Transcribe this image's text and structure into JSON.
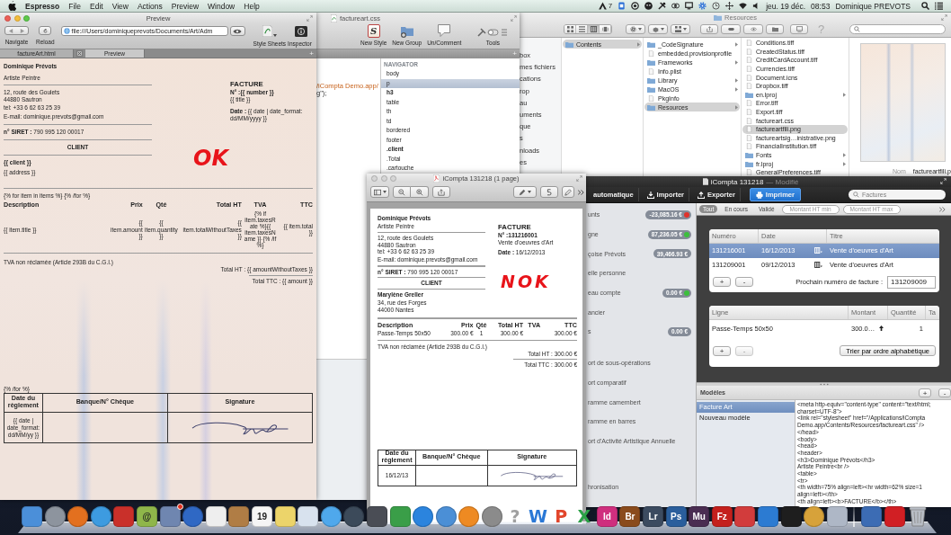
{
  "menu_bar": {
    "app_name": "Espresso",
    "menus": [
      "File",
      "Edit",
      "View",
      "Actions",
      "Preview",
      "Window",
      "Help"
    ],
    "status_count": "7",
    "date": "jeu. 19 déc.",
    "time": "08:53",
    "user": "Dominique PREVOTS"
  },
  "finder_window": {
    "title": "Resources",
    "view_buttons": [
      {
        "kind": "icons",
        "selected": false
      },
      {
        "kind": "list",
        "selected": false
      },
      {
        "kind": "columns",
        "selected": true
      },
      {
        "kind": "coverflow",
        "selected": false
      }
    ],
    "help": "?",
    "sidebar": [
      "box",
      "mes fichiers",
      "cations",
      "rop",
      "au",
      "uments",
      "que",
      "s",
      "nloads",
      "es"
    ],
    "columns": [
      [
        {
          "name": "Contents",
          "kind": "folder",
          "selected": true
        }
      ],
      [
        {
          "name": "_CodeSignature",
          "kind": "folder",
          "selected": false
        },
        {
          "name": "embedded.provisionprofile",
          "kind": "file",
          "selected": false
        },
        {
          "name": "Frameworks",
          "kind": "folder",
          "selected": false
        },
        {
          "name": "Info.plist",
          "kind": "file",
          "selected": false
        },
        {
          "name": "Library",
          "kind": "folder",
          "selected": false
        },
        {
          "name": "MacOS",
          "kind": "folder",
          "selected": false
        },
        {
          "name": "PkgInfo",
          "kind": "file",
          "selected": false
        },
        {
          "name": "Resources",
          "kind": "folder",
          "selected": true
        }
      ],
      [
        {
          "name": "Conditions.tiff",
          "kind": "file",
          "selected": false
        },
        {
          "name": "CreatedStatus.tiff",
          "kind": "file",
          "selected": false
        },
        {
          "name": "CreditCardAccount.tiff",
          "kind": "file",
          "selected": false
        },
        {
          "name": "Currencies.tiff",
          "kind": "file",
          "selected": false
        },
        {
          "name": "Document.icns",
          "kind": "file",
          "selected": false
        },
        {
          "name": "Dropbox.tiff",
          "kind": "file",
          "selected": false
        },
        {
          "name": "en.lproj",
          "kind": "folder",
          "selected": false
        },
        {
          "name": "Error.tiff",
          "kind": "file",
          "selected": false
        },
        {
          "name": "Export.tiff",
          "kind": "file",
          "selected": false
        },
        {
          "name": "factureart.css",
          "kind": "file",
          "selected": false
        },
        {
          "name": "factureartfili.png",
          "kind": "file",
          "selected": true
        },
        {
          "name": "factureartsig…inistrative.png",
          "kind": "file",
          "selected": false
        },
        {
          "name": "FinancialInstitution.tiff",
          "kind": "file",
          "selected": false
        },
        {
          "name": "Fonts",
          "kind": "folder",
          "selected": false
        },
        {
          "name": "fr.lproj",
          "kind": "folder",
          "selected": false
        },
        {
          "name": "GeneralPreferences.tiff",
          "kind": "file",
          "selected": false
        }
      ]
    ],
    "preview": {
      "label": "Nom",
      "value": "factureartfili.p"
    }
  },
  "css_window": {
    "title": "factureart.css",
    "tools": [
      {
        "kind": "style",
        "label": "New Style",
        "glyph": "S"
      },
      {
        "kind": "group",
        "label": "New Group"
      },
      {
        "kind": "comment",
        "label": "Un/Comment"
      },
      {
        "kind": "tools",
        "label": "Tools"
      }
    ],
    "add_tab": "+",
    "code": [
      {
        "text": "/iCompta Demo.app/",
        "kind": "string"
      },
      {
        "text": "g\");",
        "kind": "plain"
      }
    ],
    "navigator": {
      "heading": "NAVIGATOR",
      "items": [
        {
          "label": "body",
          "selected": false,
          "highlighted": false
        },
        {
          "label": "p",
          "selected": true,
          "highlighted": false
        },
        {
          "label": "h3",
          "selected": false,
          "highlighted": true
        },
        {
          "label": "table",
          "selected": false,
          "highlighted": false
        },
        {
          "label": "th",
          "selected": false,
          "highlighted": false
        },
        {
          "label": "td",
          "selected": false,
          "highlighted": false
        },
        {
          "label": "bordered",
          "selected": false,
          "highlighted": false
        },
        {
          "label": "footer",
          "selected": false,
          "highlighted": false
        },
        {
          "label": ".client",
          "selected": false,
          "highlighted": true
        },
        {
          "label": ".Total",
          "selected": false,
          "highlighted": false
        },
        {
          "label": ".cartouche",
          "selected": false,
          "highlighted": false
        }
      ]
    }
  },
  "icompta_window": {
    "title": "iCompta 131218",
    "status": "— Modifié",
    "toolbar": [
      {
        "kind": "plain",
        "label": "automatique",
        "selected": false
      },
      {
        "kind": "import",
        "label": "Importer",
        "selected": false
      },
      {
        "kind": "export",
        "label": "Exporter",
        "selected": false
      },
      {
        "kind": "print",
        "label": "Imprimer",
        "selected": true
      }
    ],
    "search": {
      "placeholder": "Factures"
    },
    "sidebar_groups": [
      {
        "items": [
          {
            "label": "unts",
            "amount": "-23,085.16 €",
            "color": "#e0322b"
          },
          {
            "label": "gne",
            "amount": "87,236.05 €",
            "color": "#3cbf3c"
          },
          {
            "label": "çoise Prévots",
            "amount": "39,466.93 €"
          },
          {
            "label": "elle personne"
          },
          {
            "label": "eau compte",
            "amount": "0.00 €",
            "color": "#3cbf3c"
          },
          {
            "label": "ancier"
          },
          {
            "label": "s",
            "amount": "0.00 €"
          }
        ]
      },
      {
        "items": [
          {
            "label": "ort de sous-opérations"
          },
          {
            "label": "ort comparatif"
          },
          {
            "label": "ramme camembert"
          },
          {
            "label": "ramme en barres"
          },
          {
            "label": "ort d'Activité Artistique Annuelle"
          }
        ]
      },
      {
        "items": [
          {
            "label": "hronisation"
          }
        ]
      }
    ],
    "filters": [
      {
        "label": "Tout",
        "selected": true
      },
      {
        "label": "En cours",
        "selected": false
      },
      {
        "label": "Validé",
        "selected": false
      }
    ],
    "range_fields": [
      {
        "placeholder": "Montant HT min"
      },
      {
        "placeholder": "Montant HT max"
      }
    ],
    "invoices": {
      "columns": [
        "Numéro",
        "Date",
        "Titre"
      ],
      "rows": [
        {
          "number": "131216001",
          "date": "16/12/2013",
          "title": "Vente d'oeuvres d'Art",
          "selected": true
        },
        {
          "number": "131209001",
          "date": "09/12/2013",
          "title": "Vente d'oeuvres d'Art",
          "selected": false
        }
      ],
      "add": "+",
      "remove": {
        "label": "-",
        "disabled": false
      },
      "next_label": "Prochain numéro de facture :",
      "next_value": "131209009"
    },
    "lines": {
      "columns": [
        "Ligne",
        "Montant",
        "Quantité",
        "Ta"
      ],
      "rows": [
        {
          "label": "Passe-Temps 50x50",
          "amount": "300.0…",
          "quantity": "1"
        }
      ],
      "add": "+",
      "remove": {
        "label": "-",
        "disabled": true
      },
      "sort_button": "Trier par ordre alphabétique"
    },
    "models": {
      "heading": "Modèles",
      "add": "+",
      "remove": "-",
      "items": [
        {
          "label": "Facture Art",
          "selected": true
        },
        {
          "label": "Nouveau modèle",
          "selected": false
        }
      ],
      "code": [
        "<meta http-equiv=\"content-type\" content=\"text/html;",
        "charset=UTF-8\">",
        "<link rel=\"stylesheet\" href=\"/Applications/iCompta",
        "Demo.app/Contents/Resources/factureart.css\" />",
        "</head>",
        "<body>",
        "<head>",
        "<header>",
        "<h3>Dominique Prévots</h3>",
        "Artiste Peintre<br />",
        "<table>",
        "<tr>",
        "<th width=75% align=left><hr width=62% size=1",
        "align=left></th>",
        "<th align=left><b>FACTURE</b></th>"
      ]
    }
  },
  "preview_window": {
    "title": "Preview",
    "navigate_label": "Navigate",
    "reload_label": "Reload",
    "url": "file:///Users/dominiqueprevots/Documents/Art/Adm",
    "style_sheets_label": "Style Sheets",
    "inspector_label": "Inspector",
    "tabs": [
      {
        "label": "factureArt.html",
        "selected": false
      },
      {
        "label": "Preview",
        "selected": true
      }
    ],
    "add_tab": "+",
    "annotation": "OK",
    "invoice": {
      "sender": {
        "name": "Dominique Prévots",
        "profession": "Artiste Peintre",
        "address": [
          "12, route des Goulets",
          "44880 Sautron",
          "tel: +33 6 62 63 25 39"
        ],
        "email": "E-mail: dominique.prevots@gmail.com"
      },
      "siret": "**n° SIRET :** 790 995 120 00017",
      "client_heading": "CLIENT",
      "client": {
        "name": "{{ client }}",
        "address": [
          "{{ address }}"
        ]
      },
      "heading": "FACTURE",
      "number": "N° :{{ number }}",
      "subtitle": "{{ title }}",
      "date": "**Date :** {{ date | date_format: dd/MM/yyyy }}",
      "loop_start": "{% for item in items %} {% /for %}",
      "columns": [
        "Description",
        "Prix",
        "Qté",
        "Total HT",
        "TVA",
        "TTC"
      ],
      "rows": [
        {
          "description": "{{ item.title }}",
          "price": "{{ item.amount }}",
          "quantity": "{{ item.quantity }}",
          "total_ht": "{{ item.totalWithoutTaxes }}",
          "tva": "{% if item.taxesRate %}{{ item.taxesName }} {% /if %}",
          "ttc": "{{ item.total }}"
        }
      ],
      "vat_note": "TVA non réclamée (Article 293B du C.G.I.)",
      "total_ht": "Total HT : {{ amountWithoutTaxes }}",
      "total_ttc": "Total TTC : {{ amount }}",
      "loop_end": "{% /for %}",
      "payment": {
        "columns": [
          "Date du règlement",
          "Banque/N° Chèque",
          "Signature"
        ],
        "date": "{{ date | date_format: dd/MM/yy }}"
      }
    }
  },
  "pdf_window": {
    "title": "iCompta 131218 (1 page)",
    "annotation": "NOK",
    "invoice": {
      "sender": {
        "name": "Dominique Prévots",
        "profession": "Artiste Peintre",
        "address": [
          "12, route des Goulets",
          "44880 Sautron",
          "tel: +33 6 62 63 25 39"
        ],
        "email": "E-mail: dominique.prevots@gmail.com"
      },
      "siret": "**n° SIRET :** 790 995 120 00017",
      "client_heading": "CLIENT",
      "client": {
        "name": "Marylène Greller",
        "address": [
          "34, rue des Forges",
          "44000 Nantes"
        ]
      },
      "heading": "FACTURE",
      "number": "N° :131216001",
      "subtitle": "Vente d'oeuvres d'Art",
      "date": "**Date :** 16/12/2013",
      "columns": [
        "Description",
        "Prix",
        "Qté",
        "Total HT",
        "TVA",
        "TTC"
      ],
      "rows": [
        {
          "description": "Passe-Temps 50x50",
          "price": "300.00 €",
          "quantity": "1",
          "total_ht": "300.00 €",
          "ttc": "300.00 €"
        }
      ],
      "vat_note": "TVA non réclamée (Article 293B du C.G.I.)",
      "total_ht": "Total HT : 300.00 €",
      "total_ttc": "Total TTC : 300.00 €",
      "payment": {
        "columns": [
          "Date du règlement",
          "Banque/N° Chèque",
          "Signature"
        ],
        "date": "16/12/13"
      }
    }
  },
  "dock": {
    "items": [
      {
        "kind": "tile",
        "color": "#4b8fd9",
        "badge": false
      },
      {
        "kind": "round",
        "color": "#8d949e",
        "badge": false
      },
      {
        "kind": "round",
        "color": "#e3701f",
        "badge": false
      },
      {
        "kind": "round",
        "color": "#3d9be0",
        "badge": false
      },
      {
        "kind": "tile",
        "color": "#c9302a",
        "badge": false
      },
      {
        "kind": "tile",
        "color": "#8fb64a",
        "label": "@",
        "badge": false
      },
      {
        "kind": "tile",
        "color": "#6f86b0",
        "badge": true
      },
      {
        "kind": "round",
        "color": "#2f68c4",
        "badge": false
      },
      {
        "kind": "tile",
        "color": "#eeeeee",
        "badge": false
      },
      {
        "kind": "tile",
        "color": "#b07d45",
        "badge": false
      },
      {
        "kind": "tile",
        "color": "#f5f5f5",
        "label": "19",
        "badge": false
      },
      {
        "kind": "tile",
        "color": "#ecd46a",
        "badge": false
      },
      {
        "kind": "tile",
        "color": "#d8e2ee",
        "badge": false
      },
      {
        "kind": "round",
        "color": "#4fa8ec",
        "badge": false
      },
      {
        "kind": "round",
        "color": "#3c4a5a",
        "badge": false
      },
      {
        "kind": "tile",
        "color": "#4a4d55",
        "badge": false
      },
      {
        "kind": "tile",
        "color": "#3a9e48",
        "badge": false
      },
      {
        "kind": "round",
        "color": "#2b84de",
        "badge": false
      },
      {
        "kind": "round",
        "color": "#4b8fd6",
        "badge": false
      },
      {
        "kind": "round",
        "color": "#ee8a22",
        "badge": false
      },
      {
        "kind": "round",
        "color": "#8b8b8b",
        "badge": false
      },
      {
        "kind": "glyph",
        "color": "#a0a0a0",
        "label": "?",
        "badge": false
      },
      {
        "kind": "glyph",
        "color": "#2a78d6",
        "label": "W",
        "badge": false
      },
      {
        "kind": "glyph",
        "color": "#e2462c",
        "label": "P",
        "badge": false
      },
      {
        "kind": "glyph",
        "color": "#2aa146",
        "label": "X",
        "badge": false
      },
      {
        "kind": "tile",
        "color": "#cf2f7e",
        "label": "Id",
        "badge": false
      },
      {
        "kind": "tile",
        "color": "#8a4b1c",
        "label": "Br",
        "badge": false
      },
      {
        "kind": "tile",
        "color": "#3c4b60",
        "label": "Lr",
        "badge": false
      },
      {
        "kind": "tile",
        "color": "#2a5e9c",
        "label": "Ps",
        "badge": false
      },
      {
        "kind": "tile",
        "color": "#4a2d52",
        "label": "Mu",
        "badge": false
      },
      {
        "kind": "tile",
        "color": "#c4201d",
        "label": "Fz",
        "badge": false
      },
      {
        "kind": "tile",
        "color": "#d23c3c",
        "badge": false
      },
      {
        "kind": "tile",
        "color": "#2c7bd2",
        "badge": false
      },
      {
        "kind": "tile",
        "color": "#1e1e1e",
        "badge": false
      },
      {
        "kind": "round",
        "color": "#d7a23a",
        "badge": false
      },
      {
        "kind": "tile",
        "color": "#aeb7c6",
        "badge": false
      },
      {
        "kind": "separator"
      },
      {
        "kind": "tile",
        "color": "#3c6cb4",
        "badge": false
      },
      {
        "kind": "tile",
        "color": "#d11f24",
        "badge": false
      },
      {
        "kind": "trash",
        "color": "#b9bec6",
        "badge": false
      }
    ]
  }
}
